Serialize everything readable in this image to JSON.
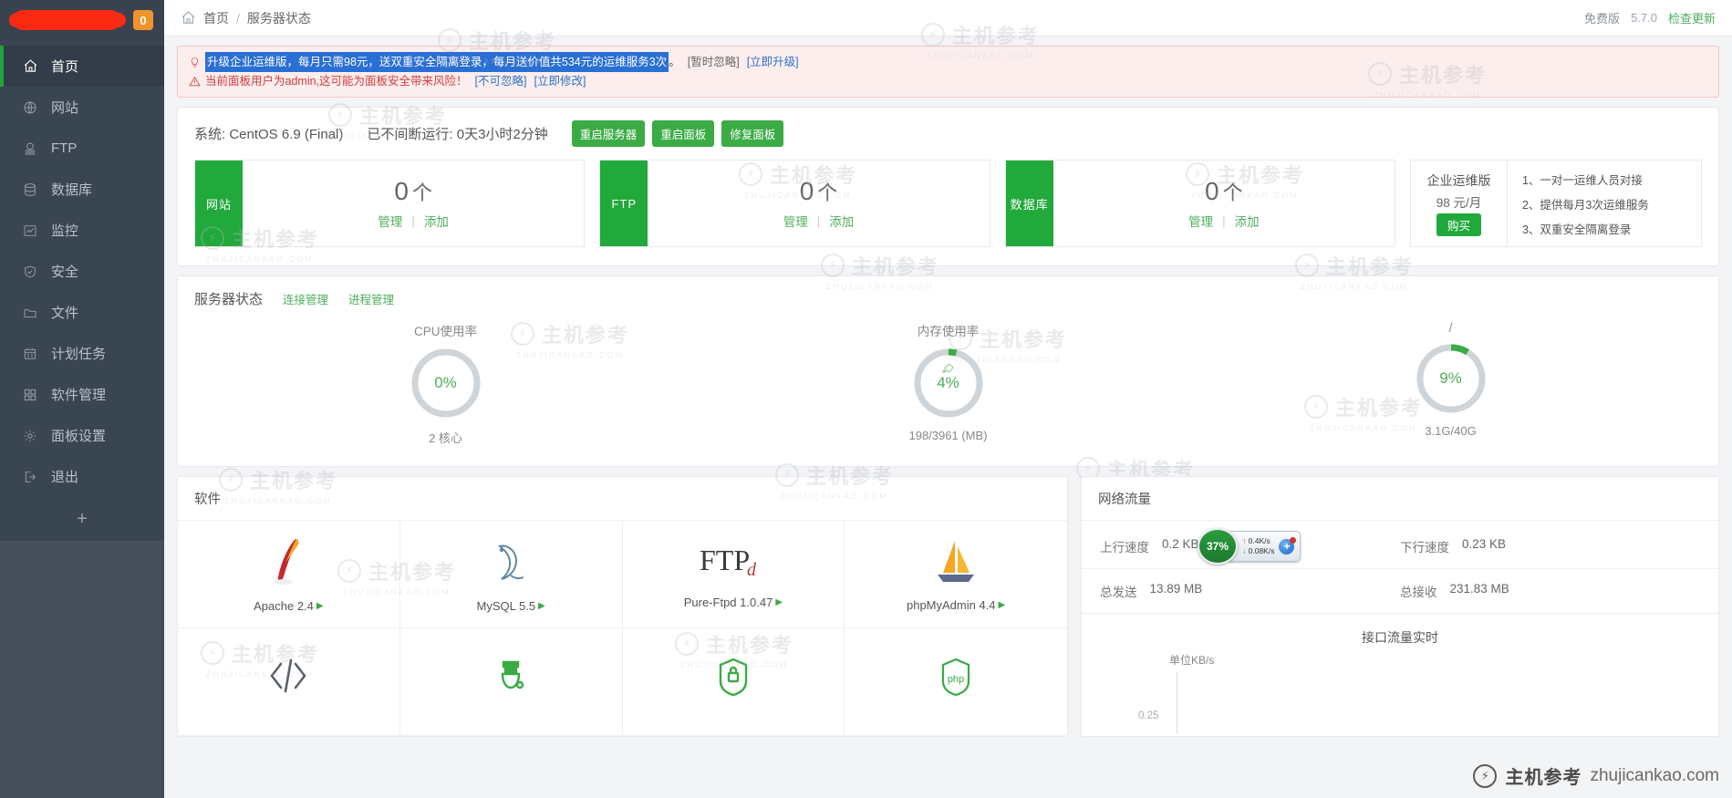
{
  "sidebar": {
    "badge": "0",
    "items": [
      {
        "label": "首页",
        "icon": "home-icon",
        "active": true
      },
      {
        "label": "网站",
        "icon": "globe-icon",
        "active": false
      },
      {
        "label": "FTP",
        "icon": "ftp-icon",
        "active": false
      },
      {
        "label": "数据库",
        "icon": "database-icon",
        "active": false
      },
      {
        "label": "监控",
        "icon": "monitor-chart-icon",
        "active": false
      },
      {
        "label": "安全",
        "icon": "shield-check-icon",
        "active": false
      },
      {
        "label": "文件",
        "icon": "folder-icon",
        "active": false
      },
      {
        "label": "计划任务",
        "icon": "calendar-icon",
        "active": false
      },
      {
        "label": "软件管理",
        "icon": "grid-apps-icon",
        "active": false
      },
      {
        "label": "面板设置",
        "icon": "gear-icon",
        "active": false
      },
      {
        "label": "退出",
        "icon": "logout-icon",
        "active": false
      }
    ],
    "add_label": "+"
  },
  "topbar": {
    "home_label": "首页",
    "separator": "/",
    "current_label": "服务器状态",
    "edition": "免费版",
    "version": "5.7.0",
    "check_update": "检查更新"
  },
  "alerts": [
    {
      "icon": "lightbulb-icon",
      "highlighted_text": "升级企业运维版，每月只需98元，送双重安全隔离登录，每月送价值共534元的运维服务3次",
      "tail": "。",
      "links": [
        "[暂时忽略]",
        "[立即升级]"
      ]
    },
    {
      "icon": "warning-triangle-icon",
      "text": "当前面板用户为admin,这可能为面板安全带来风险！",
      "links": [
        "[不可忽略]",
        "[立即修改]"
      ]
    }
  ],
  "system": {
    "os_label": "系统: CentOS 6.9 (Final)",
    "uptime_label": "已不间断运行: 0天3小时2分钟",
    "buttons": [
      "重启服务器",
      "重启面板",
      "修复面板"
    ]
  },
  "stat_cards": [
    {
      "side_label": "网站",
      "count": "0",
      "unit": "个",
      "manage": "管理",
      "divider": "|",
      "add": "添加"
    },
    {
      "side_label": "FTP",
      "count": "0",
      "unit": "个",
      "manage": "管理",
      "divider": "|",
      "add": "添加"
    },
    {
      "side_label": "数据库",
      "count": "0",
      "unit": "个",
      "manage": "管理",
      "divider": "|",
      "add": "添加"
    }
  ],
  "promo": {
    "title": "企业运维版",
    "price": "98 元/月",
    "buy_label": "购买",
    "features": [
      "1、一对一运维人员对接",
      "2、提供每月3次运维服务",
      "3、双重安全隔离登录"
    ]
  },
  "server_status": {
    "title": "服务器状态",
    "links": [
      "连接管理",
      "进程管理"
    ],
    "gauges": [
      {
        "label": "CPU使用率",
        "value": "0%",
        "percent": 0,
        "sub": "2 核心",
        "icon": ""
      },
      {
        "label": "内存使用率",
        "value": "4%",
        "percent": 4,
        "sub": "198/3961 (MB)",
        "icon": "rocket-icon"
      },
      {
        "label": "/",
        "value": "9%",
        "percent": 9,
        "sub": "3.1G/40G",
        "icon": ""
      }
    ]
  },
  "software": {
    "title": "软件",
    "items": [
      {
        "name": "Apache 2.4",
        "icon": "apache-feather-icon",
        "arrow": "▶"
      },
      {
        "name": "MySQL 5.5",
        "icon": "mysql-dolphin-icon",
        "arrow": "▶"
      },
      {
        "name": "Pure-Ftpd 1.0.47",
        "icon": "ftp-logo-icon",
        "arrow": "▶"
      },
      {
        "name": "phpMyAdmin 4.4",
        "icon": "phpmyadmin-sailboat-icon",
        "arrow": "▶"
      },
      {
        "name": "",
        "icon": "code-brackets-icon",
        "arrow": ""
      },
      {
        "name": "",
        "icon": "tomcat-icon",
        "arrow": ""
      },
      {
        "name": "",
        "icon": "ssl-lock-icon",
        "arrow": ""
      },
      {
        "name": "",
        "icon": "php-shield-icon",
        "arrow": ""
      }
    ]
  },
  "network": {
    "title": "网络流量",
    "rows": [
      {
        "left_key": "上行速度",
        "left_val": "0.2 KB",
        "right_key": "下行速度",
        "right_val": "0.23 KB"
      },
      {
        "left_key": "总发送",
        "left_val": "13.89 MB",
        "right_key": "总接收",
        "right_val": "231.83 MB"
      }
    ],
    "chart_title": "接口流量实时",
    "chart_unit": "单位KB/s",
    "chart_tick": "0.25"
  },
  "netspeed_widget": {
    "percent": "37%",
    "up_arrow": "↑",
    "up_value": "0.4K/s",
    "down_arrow": "↓",
    "down_value": "0.08K/s",
    "icon": "plus-badge-icon"
  },
  "watermark": {
    "cn": "主机参考",
    "domain": "ZHUJICANKAO.COM",
    "brandbar_cn": "主机参考",
    "brandbar_en": "zhujicankao.com"
  },
  "colors": {
    "accent_green": "#21a93b",
    "link_green": "#4fad5b",
    "sidebar_bg": "#3a4552",
    "alert_bg": "#fdeeee",
    "badge_orange": "#f0932b",
    "highlight_blue": "#2a6fd4"
  }
}
